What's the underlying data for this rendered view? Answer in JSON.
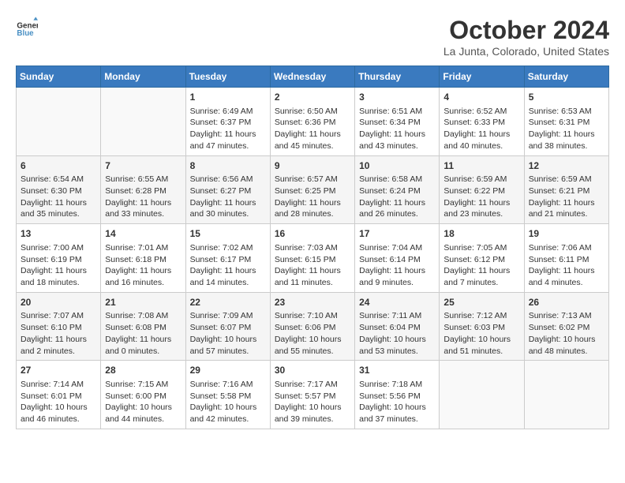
{
  "header": {
    "logo_line1": "General",
    "logo_line2": "Blue",
    "month": "October 2024",
    "location": "La Junta, Colorado, United States"
  },
  "weekdays": [
    "Sunday",
    "Monday",
    "Tuesday",
    "Wednesday",
    "Thursday",
    "Friday",
    "Saturday"
  ],
  "weeks": [
    [
      {
        "day": "",
        "info": ""
      },
      {
        "day": "",
        "info": ""
      },
      {
        "day": "1",
        "info": "Sunrise: 6:49 AM\nSunset: 6:37 PM\nDaylight: 11 hours and 47 minutes."
      },
      {
        "day": "2",
        "info": "Sunrise: 6:50 AM\nSunset: 6:36 PM\nDaylight: 11 hours and 45 minutes."
      },
      {
        "day": "3",
        "info": "Sunrise: 6:51 AM\nSunset: 6:34 PM\nDaylight: 11 hours and 43 minutes."
      },
      {
        "day": "4",
        "info": "Sunrise: 6:52 AM\nSunset: 6:33 PM\nDaylight: 11 hours and 40 minutes."
      },
      {
        "day": "5",
        "info": "Sunrise: 6:53 AM\nSunset: 6:31 PM\nDaylight: 11 hours and 38 minutes."
      }
    ],
    [
      {
        "day": "6",
        "info": "Sunrise: 6:54 AM\nSunset: 6:30 PM\nDaylight: 11 hours and 35 minutes."
      },
      {
        "day": "7",
        "info": "Sunrise: 6:55 AM\nSunset: 6:28 PM\nDaylight: 11 hours and 33 minutes."
      },
      {
        "day": "8",
        "info": "Sunrise: 6:56 AM\nSunset: 6:27 PM\nDaylight: 11 hours and 30 minutes."
      },
      {
        "day": "9",
        "info": "Sunrise: 6:57 AM\nSunset: 6:25 PM\nDaylight: 11 hours and 28 minutes."
      },
      {
        "day": "10",
        "info": "Sunrise: 6:58 AM\nSunset: 6:24 PM\nDaylight: 11 hours and 26 minutes."
      },
      {
        "day": "11",
        "info": "Sunrise: 6:59 AM\nSunset: 6:22 PM\nDaylight: 11 hours and 23 minutes."
      },
      {
        "day": "12",
        "info": "Sunrise: 6:59 AM\nSunset: 6:21 PM\nDaylight: 11 hours and 21 minutes."
      }
    ],
    [
      {
        "day": "13",
        "info": "Sunrise: 7:00 AM\nSunset: 6:19 PM\nDaylight: 11 hours and 18 minutes."
      },
      {
        "day": "14",
        "info": "Sunrise: 7:01 AM\nSunset: 6:18 PM\nDaylight: 11 hours and 16 minutes."
      },
      {
        "day": "15",
        "info": "Sunrise: 7:02 AM\nSunset: 6:17 PM\nDaylight: 11 hours and 14 minutes."
      },
      {
        "day": "16",
        "info": "Sunrise: 7:03 AM\nSunset: 6:15 PM\nDaylight: 11 hours and 11 minutes."
      },
      {
        "day": "17",
        "info": "Sunrise: 7:04 AM\nSunset: 6:14 PM\nDaylight: 11 hours and 9 minutes."
      },
      {
        "day": "18",
        "info": "Sunrise: 7:05 AM\nSunset: 6:12 PM\nDaylight: 11 hours and 7 minutes."
      },
      {
        "day": "19",
        "info": "Sunrise: 7:06 AM\nSunset: 6:11 PM\nDaylight: 11 hours and 4 minutes."
      }
    ],
    [
      {
        "day": "20",
        "info": "Sunrise: 7:07 AM\nSunset: 6:10 PM\nDaylight: 11 hours and 2 minutes."
      },
      {
        "day": "21",
        "info": "Sunrise: 7:08 AM\nSunset: 6:08 PM\nDaylight: 11 hours and 0 minutes."
      },
      {
        "day": "22",
        "info": "Sunrise: 7:09 AM\nSunset: 6:07 PM\nDaylight: 10 hours and 57 minutes."
      },
      {
        "day": "23",
        "info": "Sunrise: 7:10 AM\nSunset: 6:06 PM\nDaylight: 10 hours and 55 minutes."
      },
      {
        "day": "24",
        "info": "Sunrise: 7:11 AM\nSunset: 6:04 PM\nDaylight: 10 hours and 53 minutes."
      },
      {
        "day": "25",
        "info": "Sunrise: 7:12 AM\nSunset: 6:03 PM\nDaylight: 10 hours and 51 minutes."
      },
      {
        "day": "26",
        "info": "Sunrise: 7:13 AM\nSunset: 6:02 PM\nDaylight: 10 hours and 48 minutes."
      }
    ],
    [
      {
        "day": "27",
        "info": "Sunrise: 7:14 AM\nSunset: 6:01 PM\nDaylight: 10 hours and 46 minutes."
      },
      {
        "day": "28",
        "info": "Sunrise: 7:15 AM\nSunset: 6:00 PM\nDaylight: 10 hours and 44 minutes."
      },
      {
        "day": "29",
        "info": "Sunrise: 7:16 AM\nSunset: 5:58 PM\nDaylight: 10 hours and 42 minutes."
      },
      {
        "day": "30",
        "info": "Sunrise: 7:17 AM\nSunset: 5:57 PM\nDaylight: 10 hours and 39 minutes."
      },
      {
        "day": "31",
        "info": "Sunrise: 7:18 AM\nSunset: 5:56 PM\nDaylight: 10 hours and 37 minutes."
      },
      {
        "day": "",
        "info": ""
      },
      {
        "day": "",
        "info": ""
      }
    ]
  ]
}
